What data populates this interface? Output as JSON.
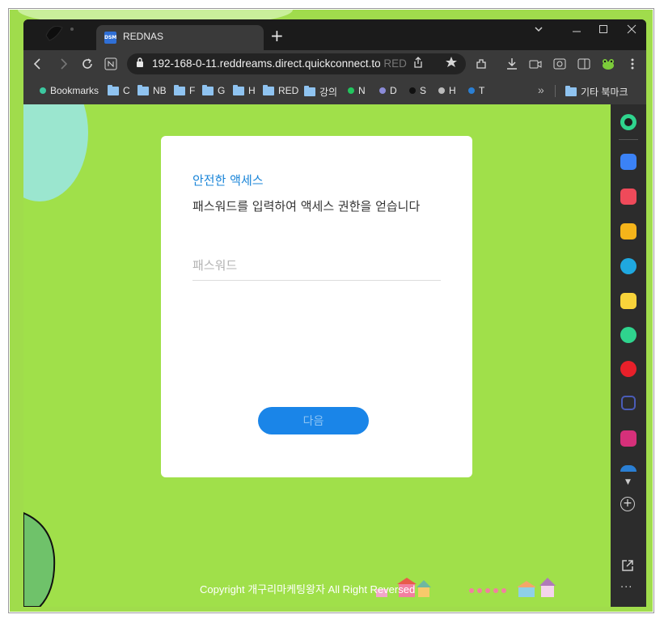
{
  "browser": {
    "tab_title": "REDNAS",
    "tab_favicon_text": "DSM",
    "url": "192-168-0-11.reddreams.direct.quickconnect.to",
    "url_faded": "RED"
  },
  "bookmarks": [
    {
      "label": "Bookmarks",
      "kind": "dot",
      "color": "#3cc8a0"
    },
    {
      "label": "C",
      "kind": "folder"
    },
    {
      "label": "NB",
      "kind": "folder"
    },
    {
      "label": "F",
      "kind": "folder"
    },
    {
      "label": "G",
      "kind": "folder"
    },
    {
      "label": "H",
      "kind": "folder"
    },
    {
      "label": "RED",
      "kind": "folder"
    },
    {
      "label": "강의",
      "kind": "folder"
    },
    {
      "label": "N",
      "kind": "dot",
      "color": "#22c55e"
    },
    {
      "label": "D",
      "kind": "dot",
      "color": "#8b8bd8"
    },
    {
      "label": "S",
      "kind": "dot",
      "color": "#111111"
    },
    {
      "label": "H",
      "kind": "dot",
      "color": "#bbbbbb"
    },
    {
      "label": "T",
      "kind": "dot",
      "color": "#2a7fd4"
    }
  ],
  "bookmarks_overflow": "»",
  "other_bookmarks": "기타 북마크",
  "login": {
    "heading": "안전한 액세스",
    "description": "패스워드를 입력하여 액세스 권한을 얻습니다",
    "password_placeholder": "패스워드",
    "next_label": "다음"
  },
  "footer": {
    "copyright": "Copyright 개구리마케팅왕자 All Right Reversed"
  },
  "colors": {
    "page_bg": "#a0e04a",
    "accent": "#1a85e8"
  }
}
